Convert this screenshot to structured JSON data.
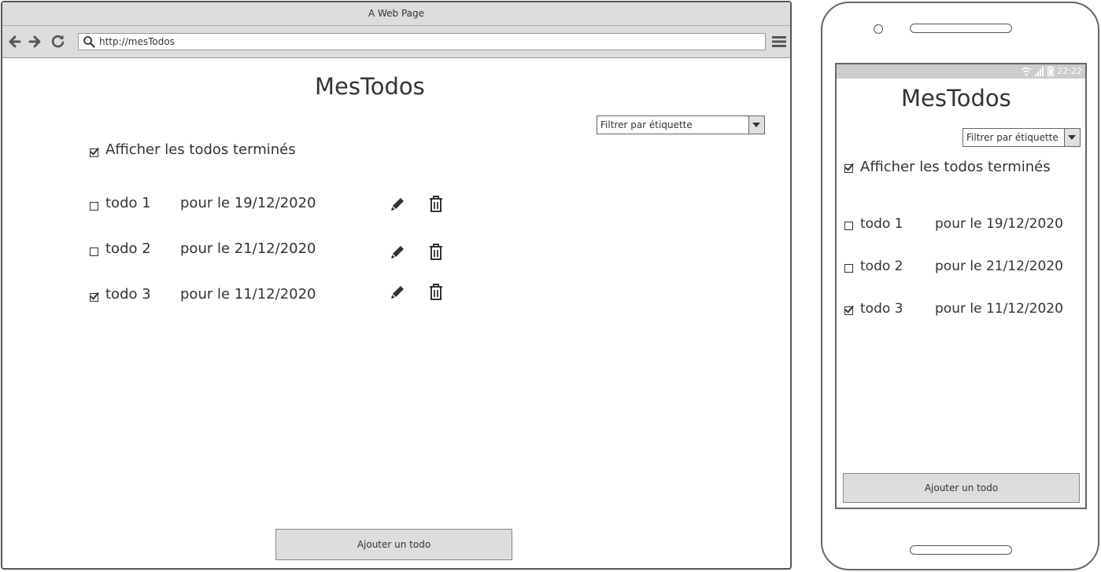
{
  "browser": {
    "window_title": "A Web Page",
    "url": "http://mesTodos",
    "icons": [
      "back-arrow-icon",
      "forward-arrow-icon",
      "reload-icon",
      "search-icon",
      "menu-icon"
    ]
  },
  "app": {
    "title": "MesTodos",
    "filter": {
      "label": "Filtrer par étiquette",
      "icon": "chevron-down-icon"
    },
    "show_done": {
      "label": "Afficher les todos terminés",
      "checked": true
    },
    "todos": [
      {
        "name": "todo 1",
        "due": "pour le 19/12/2020",
        "checked": false
      },
      {
        "name": "todo 2",
        "due": "pour le 21/12/2020",
        "checked": false
      },
      {
        "name": "todo 3",
        "due": "pour le 11/12/2020",
        "checked": true
      }
    ],
    "row_icons": [
      "pencil-icon",
      "trash-icon"
    ],
    "add_button": "Ajouter un todo"
  },
  "phone": {
    "status_time": "22:22",
    "status_icons": [
      "wifi-icon",
      "signal-icon",
      "battery-icon"
    ]
  },
  "colors": {
    "chrome": "#dddddd",
    "border": "#555555",
    "text": "#333333",
    "status_bar": "#cccccc"
  }
}
